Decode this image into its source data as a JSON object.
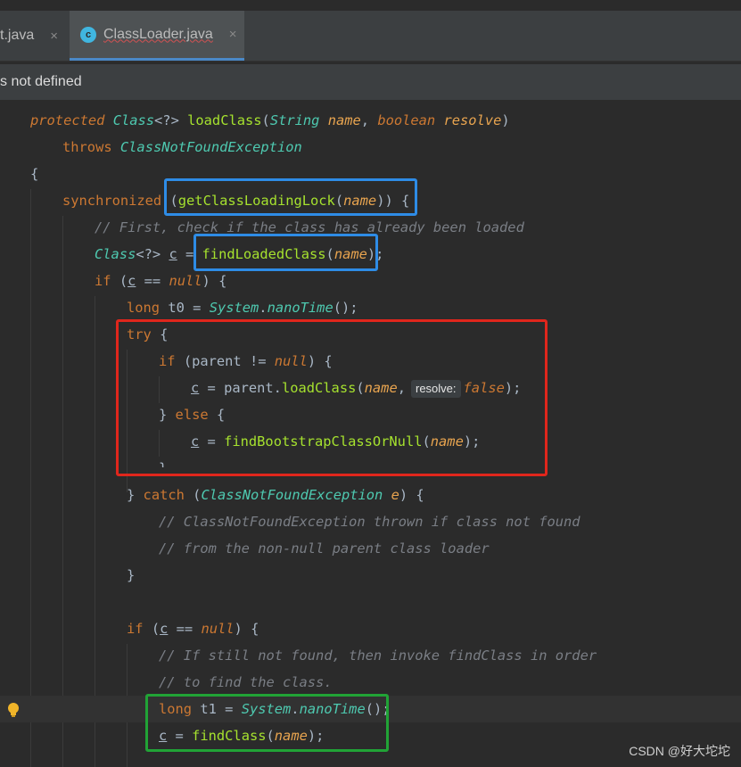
{
  "tabs": [
    {
      "label": "t.java",
      "close": "×"
    },
    {
      "label": "ClassLoader.java",
      "close": "×",
      "icon_text": "c"
    }
  ],
  "banner": {
    "text": "s not defined"
  },
  "code": {
    "l1": {
      "protected": "protected",
      "Class": "Class",
      "wild": "<?>",
      "name": "loadClass",
      "open": "(",
      "String": "String",
      "p1": "name",
      "comma": ", ",
      "boolean": "boolean",
      "p2": "resolve",
      "close": ")"
    },
    "l2": {
      "throws": "throws",
      "exc": "ClassNotFoundException"
    },
    "l3": {
      "brace": "{"
    },
    "l4": {
      "sync": "synchronized",
      "open": "(",
      "fn": "getClassLoadingLock",
      "po": "(",
      "p": "name",
      "pc": "))",
      "brace": " {"
    },
    "l5": {
      "cmt": "// First, check if the class has already been loaded"
    },
    "l6": {
      "Class": "Class",
      "wild": "<?>",
      "var": "c",
      "eq": " = ",
      "fn": "findLoadedClass",
      "po": "(",
      "p": "name",
      "pc": ");"
    },
    "l7": {
      "if": "if",
      "po": " (",
      "var": "c",
      "op": " == ",
      "null": "null",
      "pc": ") {"
    },
    "l8": {
      "long": "long",
      "rest": " t0 = ",
      "System": "System",
      "dot": ".",
      "fn": "nanoTime",
      "end": "();"
    },
    "l9": {
      "try": "try",
      "brace": " {"
    },
    "l10": {
      "if": "if",
      "po": " (parent != ",
      "null": "null",
      "pc": ") {"
    },
    "l11": {
      "var": "c",
      "mid": " = parent.",
      "fn": "loadClass",
      "po": "(",
      "p": "name",
      "comma": ",",
      "hint": "resolve:",
      "false": "false",
      "pc": ");"
    },
    "l12": {
      "close": "} ",
      "else": "else",
      "brace": " {"
    },
    "l13": {
      "var": "c",
      "eq": " = ",
      "fn": "findBootstrapClassOrNull",
      "po": "(",
      "p": "name",
      "pc": ");"
    },
    "l14": {
      "brace": "}"
    },
    "l15": {
      "close": "} ",
      "catch": "catch",
      "po": " (",
      "exc": "ClassNotFoundException",
      "sp": " ",
      "e": "e",
      "pc": ") {"
    },
    "l16": {
      "cmt": "// ClassNotFoundException thrown if class not found"
    },
    "l17": {
      "cmt": "// from the non-null parent class loader"
    },
    "l18": {
      "brace": "}"
    },
    "l20": {
      "if": "if",
      "po": " (",
      "var": "c",
      "op": " == ",
      "null": "null",
      "pc": ") {"
    },
    "l21": {
      "cmt": "// If still not found, then invoke findClass in order"
    },
    "l22": {
      "cmt": "// to find the class."
    },
    "l23": {
      "long": "long",
      "rest": " t1 = ",
      "System": "System",
      "dot": ".",
      "fn": "nanoTime",
      "end": "();"
    },
    "l24": {
      "var": "c",
      "eq": " = ",
      "fn": "findClass",
      "po": "(",
      "p": "name",
      "pc": ");"
    }
  },
  "watermark": "CSDN @好大坨坨",
  "colors": {
    "blue_box": "#2e8ce6",
    "red_box": "#e0261c",
    "green_box": "#21a336"
  }
}
